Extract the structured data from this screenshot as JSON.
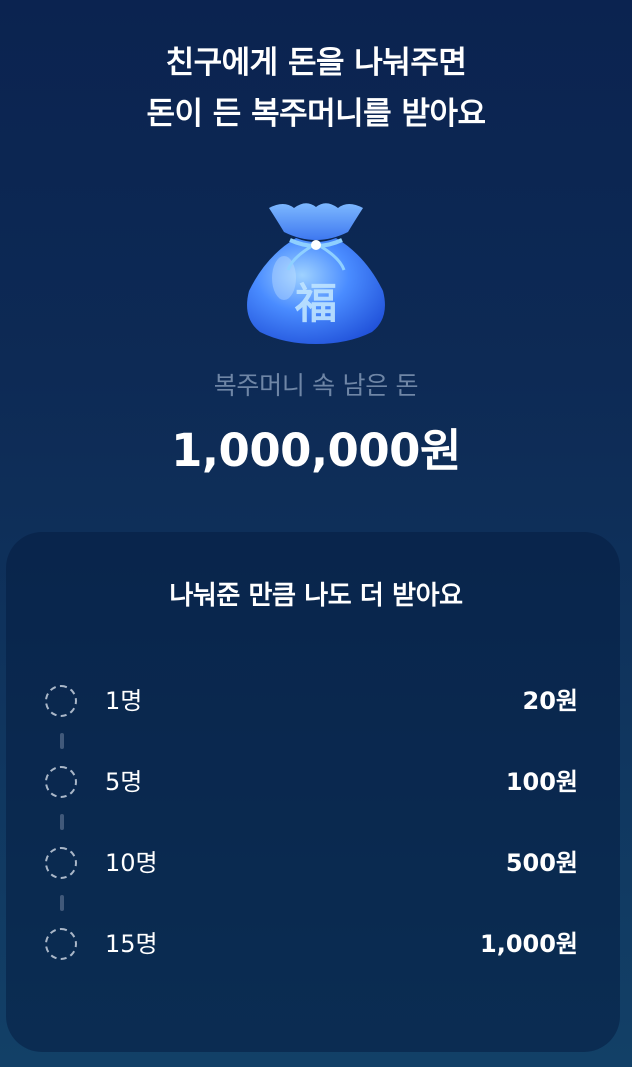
{
  "headline": {
    "line1": "친구에게 돈을 나눠주면",
    "line2": "돈이 든 복주머니를 받아요"
  },
  "pouch": {
    "icon": "lucky-pouch-icon",
    "character": "福",
    "colors": {
      "body": "#4a8cff",
      "body_dark": "#1f4fd8",
      "rope": "#8fd0ff"
    }
  },
  "balance": {
    "label": "복주머니 속 남은 돈",
    "amount": "1,000,000원"
  },
  "rewards": {
    "title": "나눠준 만큼 나도 더 받아요",
    "tiers": [
      {
        "people": "1명",
        "reward": "20원"
      },
      {
        "people": "5명",
        "reward": "100원"
      },
      {
        "people": "10명",
        "reward": "500원"
      },
      {
        "people": "15명",
        "reward": "1,000원"
      }
    ]
  }
}
